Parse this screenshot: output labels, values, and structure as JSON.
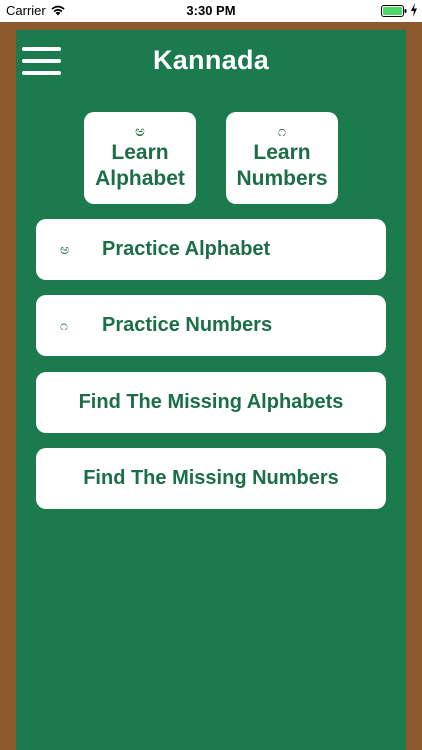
{
  "status_bar": {
    "carrier": "Carrier",
    "time": "3:30 PM",
    "icons": [
      "wifi-icon",
      "battery-icon",
      "charging-icon"
    ]
  },
  "header": {
    "title": "Kannada",
    "menu_icon": "hamburger-menu-icon"
  },
  "tiles": [
    {
      "glyph": "ಅ",
      "line1": "Learn",
      "line2": "Alphabet"
    },
    {
      "glyph": "೧",
      "line1": "Learn",
      "line2": "Numbers"
    }
  ],
  "buttons": [
    {
      "glyph": "ಅ",
      "label": "Practice Alphabet"
    },
    {
      "glyph": "೧",
      "label": "Practice Numbers"
    },
    {
      "label": "Find The Missing Alphabets"
    },
    {
      "label": "Find The Missing Numbers"
    }
  ],
  "colors": {
    "board_green": "#1b7a4e",
    "frame_brown": "#8a5a2c",
    "text_green": "#1b6e46",
    "battery_green": "#4cd964"
  }
}
